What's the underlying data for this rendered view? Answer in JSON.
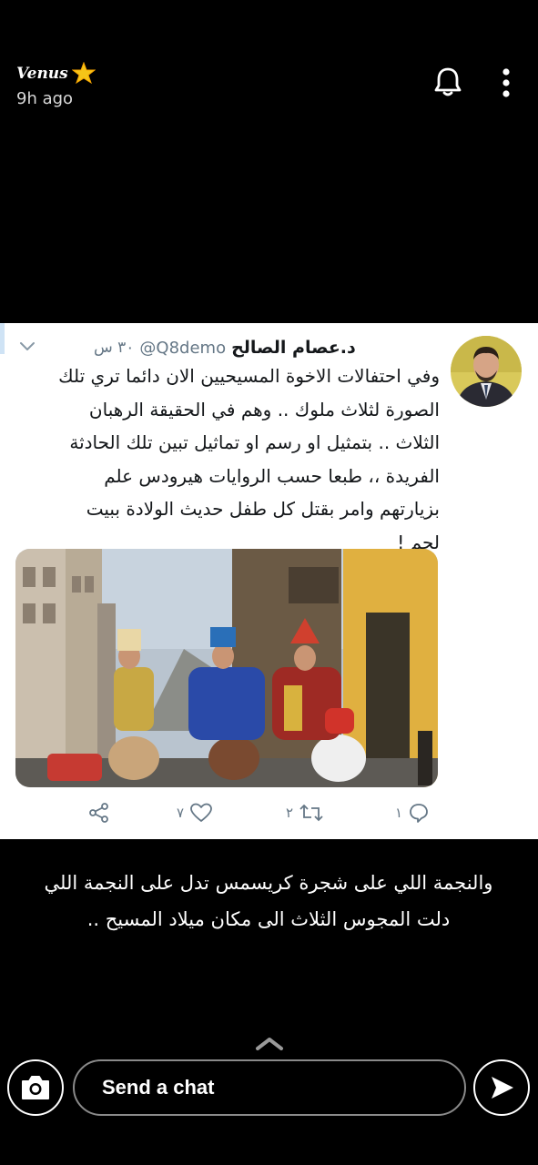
{
  "header": {
    "user_name": "Venus",
    "time_ago": "9h ago",
    "icons": {
      "star": "star-emoji-icon",
      "bell": "bell-icon",
      "more": "more-vertical-icon"
    }
  },
  "tweet": {
    "display_name": "د.عصام الصالح",
    "handle": "@Q8demo",
    "time": "٣٠ س",
    "text": "وفي احتفالات الاخوة المسيحيين الان دائما تري تلك\nالصورة لثلاث ملوك .. وهم في الحقيقة الرهبان\nالثلاث .. بتمثيل او رسم او  تماثيل تبين تلك الحادثة\nالفريدة ،، طبعا حسب الروايات هيرودس علم\nبزيارتهم وامر بقتل كل طفل حديث الولادة ببيت\nلحم !",
    "actions": {
      "replies": "١",
      "retweets": "٢",
      "likes": "٧"
    }
  },
  "caption": "والنجمة اللي على شجرة كريسمس تدل على النجمة اللي\nدلت المجوس الثلاث الى مكان ميلاد المسيح ..",
  "chat": {
    "placeholder": "Send a chat"
  },
  "colors": {
    "background": "#000000",
    "card": "#ffffff",
    "twitter_gray": "#657786",
    "text": "#14171a"
  }
}
